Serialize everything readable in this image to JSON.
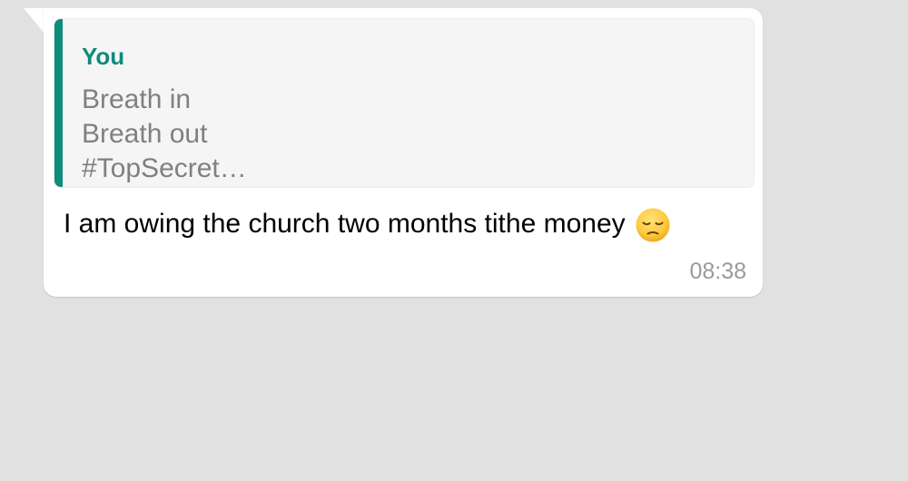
{
  "message": {
    "quote": {
      "author": "You",
      "lines": [
        "Breath in",
        "Breath out",
        "#TopSecret…"
      ],
      "accent_color": "#0e8c7c"
    },
    "text": "I am owing the church two months tithe money",
    "emoji": "pensive-face-icon",
    "timestamp": "08:38"
  },
  "colors": {
    "background": "#e1e1e1",
    "bubble": "#ffffff",
    "quote_background": "#f5f5f5",
    "quote_text": "#808080",
    "timestamp": "#9a9a9a"
  }
}
